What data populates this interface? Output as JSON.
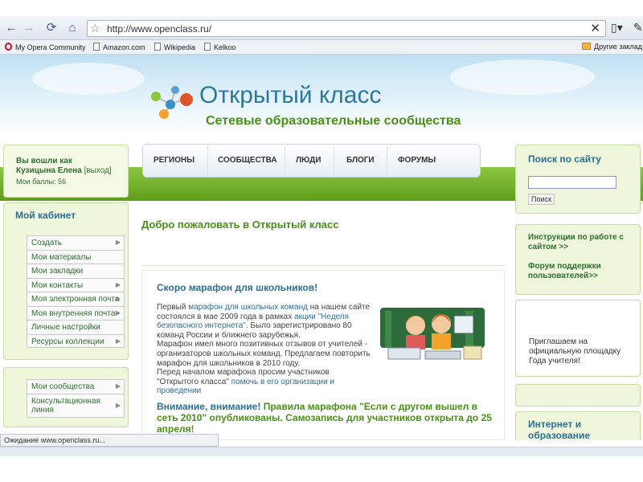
{
  "browser": {
    "url": "http://www.openclass.ru/",
    "bookmarks": [
      "My Opera Community",
      "Amazon.com",
      "Wikipedia",
      "Kelkoo"
    ],
    "other_bookmarks": "Другие заклад",
    "status": "Ожидание www.openclass.ru..."
  },
  "logo": {
    "title": "Открытый класс",
    "subtitle": "Сетевые образовательные сообщества"
  },
  "login": {
    "line1": "Вы вошли как",
    "user": "Кузицына Елена",
    "exit": "[выход]",
    "points": "Мои баллы: 56"
  },
  "nav": [
    "РЕГИОНЫ",
    "СООБЩЕСТВА",
    "ЛЮДИ",
    "БЛОГИ",
    "ФОРУМЫ"
  ],
  "cabinet": {
    "title": "Мой кабинет",
    "items": [
      {
        "label": "Создать",
        "arrow": true
      },
      {
        "label": "Мои материалы",
        "arrow": false
      },
      {
        "label": "Мои закладки",
        "arrow": false
      },
      {
        "label": "Мои контакты",
        "arrow": true
      },
      {
        "label": "Моя электронная почта",
        "arrow": true
      },
      {
        "label": "Моя внутренняя почта",
        "arrow": true
      },
      {
        "label": "Личные настройки",
        "arrow": false
      },
      {
        "label": "Ресурсы коллекции",
        "arrow": true
      }
    ]
  },
  "communities": {
    "items": [
      {
        "label": "Мои сообщества",
        "arrow": true
      },
      {
        "label": "Консультационная линия",
        "arrow": true
      }
    ]
  },
  "main": {
    "welcome": "Добро пожаловать в Открытый класс",
    "news_title": "Скоро марафон для школьников!",
    "p1a": "Первый ",
    "p1_link1": "марафон для школьных команд",
    "p1b": " на нашем сайте состоялся в мае 2009 года в рамках ",
    "p1_link2": "акции \"Неделя безопасного интернета\"",
    "p1c": ". Было зарегистрировано 80 команд России и ближнего зарубежья.",
    "p2": "Марафон имел много позитивных отзывов от учителей - организаторов школьных команд. Предлагаем повторить марафон для школьников в 2010 году.",
    "p3a": "Перед началом марафона просим участников \"Открытого класса\" ",
    "p3_link": "помочь в его организации и проведении",
    "attn_a": "Внимание, внимание! ",
    "attn_b": "Правила марафона \"Если с другом вышел в сеть 2010\" опубликованы. Самозапись для участников открыта до 25 апреля!"
  },
  "right": {
    "search_title": "Поиск по сайту",
    "search_value": "",
    "search_button": "Поиск",
    "instr1": "Инструкции по работе с сайтом >>",
    "instr2": "Форум поддержки пользователей>>",
    "invite": "Приглашаем на официальную площадку Года учителя!",
    "internet_title": "Интернет и образование"
  }
}
